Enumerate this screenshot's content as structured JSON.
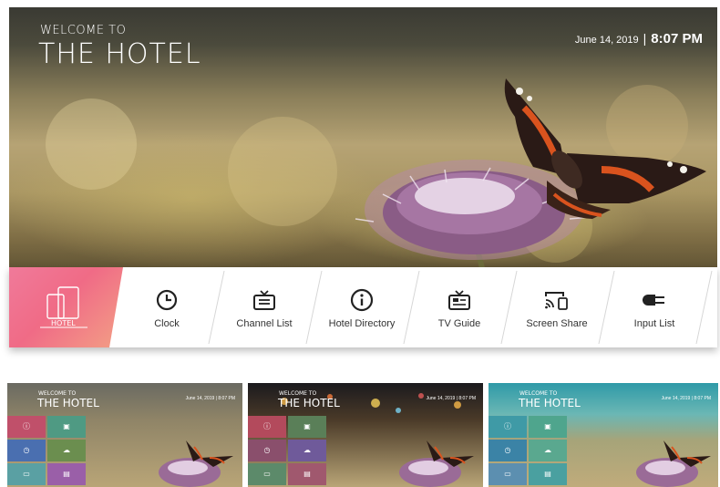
{
  "hero": {
    "welcome": "WELCOME TO",
    "hotel_name": "THE HOTEL",
    "date": "June 14, 2019",
    "separator": "|",
    "time": "8:07 PM"
  },
  "menu": {
    "logo_label": "HOTEL",
    "items": [
      {
        "label": "Clock",
        "icon": "clock-icon"
      },
      {
        "label": "Channel List",
        "icon": "tv-icon"
      },
      {
        "label": "Hotel Directory",
        "icon": "info-icon"
      },
      {
        "label": "TV Guide",
        "icon": "tv-guide-icon"
      },
      {
        "label": "Screen Share",
        "icon": "screen-share-icon"
      },
      {
        "label": "Input List",
        "icon": "input-plug-icon"
      }
    ]
  },
  "previews": [
    {
      "welcome": "WELCOME TO",
      "hotel_name": "THE HOTEL",
      "date_time": "June 14, 2019 | 8:07 PM",
      "theme": "sunset"
    },
    {
      "welcome": "WELCOME TO",
      "hotel_name": "THE HOTEL",
      "date_time": "June 14, 2019 | 8:07 PM",
      "theme": "night-city"
    },
    {
      "welcome": "WELCOME TO",
      "hotel_name": "THE HOTEL",
      "date_time": "June 14, 2019 | 8:07 PM",
      "theme": "teal-sky"
    }
  ],
  "colors": {
    "logo_tile": "#f06b86",
    "menu_text": "#333333",
    "preview_tiles": [
      "#c0506a",
      "#4f9a83",
      "#4a6fb0",
      "#6b8e4f",
      "#9a5fa8",
      "#5aa0a3"
    ]
  }
}
